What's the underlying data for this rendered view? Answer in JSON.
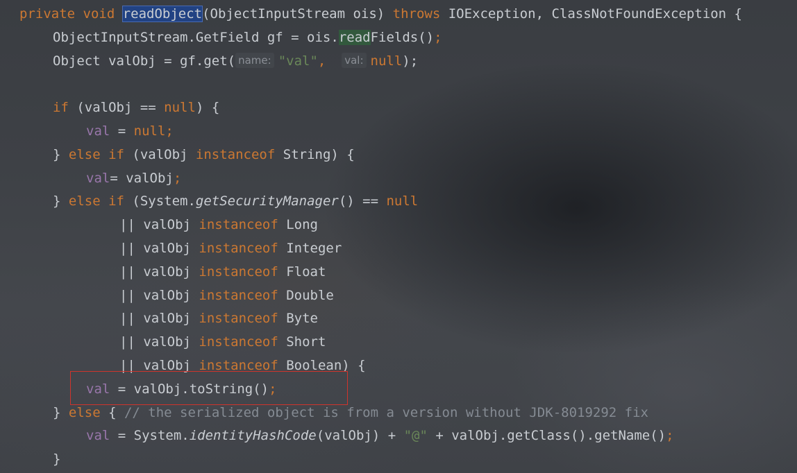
{
  "editor": {
    "lines": [
      {
        "indent": 0,
        "tokens": [
          {
            "t": "private ",
            "c": "kw"
          },
          {
            "t": "void ",
            "c": "kw"
          },
          {
            "t": "readObject",
            "c": "plain hl-method"
          },
          {
            "t": "(ObjectInputStream ois) ",
            "c": "plain"
          },
          {
            "t": "throws ",
            "c": "kw"
          },
          {
            "t": "IOException, ClassNotFoundException {",
            "c": "plain"
          }
        ]
      },
      {
        "indent": 1,
        "tokens": [
          {
            "t": "ObjectInputStream.GetField gf = ois.",
            "c": "plain"
          },
          {
            "t": "read",
            "c": "plain hl-usage"
          },
          {
            "t": "Fields()",
            "c": "plain"
          },
          {
            "t": ";",
            "c": "kw"
          }
        ]
      },
      {
        "indent": 1,
        "tokens": [
          {
            "t": "Object valObj = gf.get(",
            "c": "plain"
          },
          {
            "t": "name:",
            "c": "hint"
          },
          {
            "t": "\"val\"",
            "c": "str"
          },
          {
            "t": ",  ",
            "c": "kw"
          },
          {
            "t": "val:",
            "c": "hint"
          },
          {
            "t": "null",
            "c": "kw"
          },
          {
            "t": ");",
            "c": "plain"
          }
        ]
      },
      {
        "indent": 0,
        "tokens": []
      },
      {
        "indent": 1,
        "tokens": [
          {
            "t": "if ",
            "c": "kw"
          },
          {
            "t": "(valObj == ",
            "c": "plain"
          },
          {
            "t": "null",
            "c": "kw"
          },
          {
            "t": ") {",
            "c": "plain"
          }
        ]
      },
      {
        "indent": 2,
        "tokens": [
          {
            "t": "val",
            "c": "fld"
          },
          {
            "t": " = ",
            "c": "plain"
          },
          {
            "t": "null",
            "c": "kw"
          },
          {
            "t": ";",
            "c": "kw"
          }
        ]
      },
      {
        "indent": 1,
        "tokens": [
          {
            "t": "} ",
            "c": "plain"
          },
          {
            "t": "else if ",
            "c": "kw"
          },
          {
            "t": "(valObj ",
            "c": "plain"
          },
          {
            "t": "instanceof ",
            "c": "kw"
          },
          {
            "t": "String) {",
            "c": "plain"
          }
        ]
      },
      {
        "indent": 2,
        "tokens": [
          {
            "t": "val",
            "c": "fld"
          },
          {
            "t": "= valObj",
            "c": "plain"
          },
          {
            "t": ";",
            "c": "kw"
          }
        ]
      },
      {
        "indent": 1,
        "tokens": [
          {
            "t": "} ",
            "c": "plain"
          },
          {
            "t": "else if ",
            "c": "kw"
          },
          {
            "t": "(System.",
            "c": "plain"
          },
          {
            "t": "getSecurityManager",
            "c": "plain italic"
          },
          {
            "t": "() == ",
            "c": "plain"
          },
          {
            "t": "null",
            "c": "kw"
          }
        ]
      },
      {
        "indent": 3,
        "tokens": [
          {
            "t": "|| valObj ",
            "c": "plain"
          },
          {
            "t": "instanceof ",
            "c": "kw"
          },
          {
            "t": "Long",
            "c": "plain"
          }
        ]
      },
      {
        "indent": 3,
        "tokens": [
          {
            "t": "|| valObj ",
            "c": "plain"
          },
          {
            "t": "instanceof ",
            "c": "kw"
          },
          {
            "t": "Integer",
            "c": "plain"
          }
        ]
      },
      {
        "indent": 3,
        "tokens": [
          {
            "t": "|| valObj ",
            "c": "plain"
          },
          {
            "t": "instanceof ",
            "c": "kw"
          },
          {
            "t": "Float",
            "c": "plain"
          }
        ]
      },
      {
        "indent": 3,
        "tokens": [
          {
            "t": "|| valObj ",
            "c": "plain"
          },
          {
            "t": "instanceof ",
            "c": "kw"
          },
          {
            "t": "Double",
            "c": "plain"
          }
        ]
      },
      {
        "indent": 3,
        "tokens": [
          {
            "t": "|| valObj ",
            "c": "plain"
          },
          {
            "t": "instanceof ",
            "c": "kw"
          },
          {
            "t": "Byte",
            "c": "plain"
          }
        ]
      },
      {
        "indent": 3,
        "tokens": [
          {
            "t": "|| valObj ",
            "c": "plain"
          },
          {
            "t": "instanceof ",
            "c": "kw"
          },
          {
            "t": "Short",
            "c": "plain"
          }
        ]
      },
      {
        "indent": 3,
        "tokens": [
          {
            "t": "|| valObj ",
            "c": "plain"
          },
          {
            "t": "instanceof ",
            "c": "kw"
          },
          {
            "t": "Boolean) {",
            "c": "plain"
          }
        ]
      },
      {
        "indent": 2,
        "tokens": [
          {
            "t": "val",
            "c": "fld"
          },
          {
            "t": " = valObj.toString()",
            "c": "plain"
          },
          {
            "t": ";",
            "c": "kw"
          }
        ]
      },
      {
        "indent": 1,
        "tokens": [
          {
            "t": "} ",
            "c": "plain"
          },
          {
            "t": "else ",
            "c": "kw"
          },
          {
            "t": "{ ",
            "c": "plain"
          },
          {
            "t": "// the serialized object is from a version without JDK-8019292 fix",
            "c": "cmt"
          }
        ]
      },
      {
        "indent": 2,
        "tokens": [
          {
            "t": "val",
            "c": "fld"
          },
          {
            "t": " = System.",
            "c": "plain"
          },
          {
            "t": "identityHashCode",
            "c": "plain italic"
          },
          {
            "t": "(valObj) + ",
            "c": "plain"
          },
          {
            "t": "\"@\"",
            "c": "str"
          },
          {
            "t": " + valObj.getClass().getName()",
            "c": "plain"
          },
          {
            "t": ";",
            "c": "kw"
          }
        ]
      },
      {
        "indent": 1,
        "tokens": [
          {
            "t": "}",
            "c": "plain"
          }
        ]
      }
    ]
  },
  "colors": {
    "keyword": "#cc7832",
    "field": "#9876aa",
    "string": "#6a8759",
    "comment": "#858b93",
    "text": "#c9cdd2",
    "highlight_box": "#d0342c"
  }
}
